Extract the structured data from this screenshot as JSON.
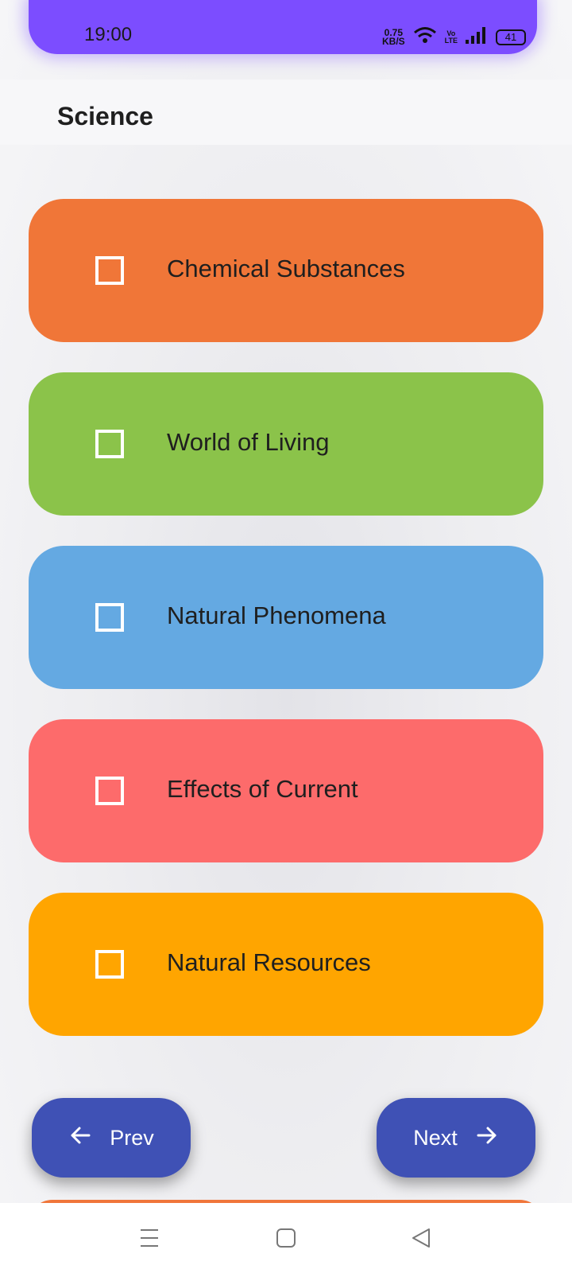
{
  "status_bar": {
    "time": "19:00",
    "net_speed_value": "0.75",
    "net_speed_unit": "KB/S",
    "volte_top": "Vo",
    "volte_bottom": "LTE",
    "battery": "41"
  },
  "header": {
    "title": "Science"
  },
  "topics": [
    {
      "label": "Chemical Substances",
      "color": "#f07638",
      "checked": false
    },
    {
      "label": "World of Living",
      "color": "#8bc34a",
      "checked": false
    },
    {
      "label": "Natural Phenomena",
      "color": "#64a9e2",
      "checked": false
    },
    {
      "label": "Effects of Current",
      "color": "#fd6b6b",
      "checked": false
    },
    {
      "label": "Natural Resources",
      "color": "#ffa500",
      "checked": false
    }
  ],
  "navigation": {
    "prev_label": "Prev",
    "next_label": "Next",
    "button_color": "#3f51b5"
  },
  "icons": {
    "wifi": "wifi-icon",
    "signal": "signal-icon",
    "arrow_left": "arrow-left-icon",
    "arrow_right": "arrow-right-icon",
    "menu": "menu-icon",
    "home": "home-icon",
    "back": "back-icon"
  }
}
